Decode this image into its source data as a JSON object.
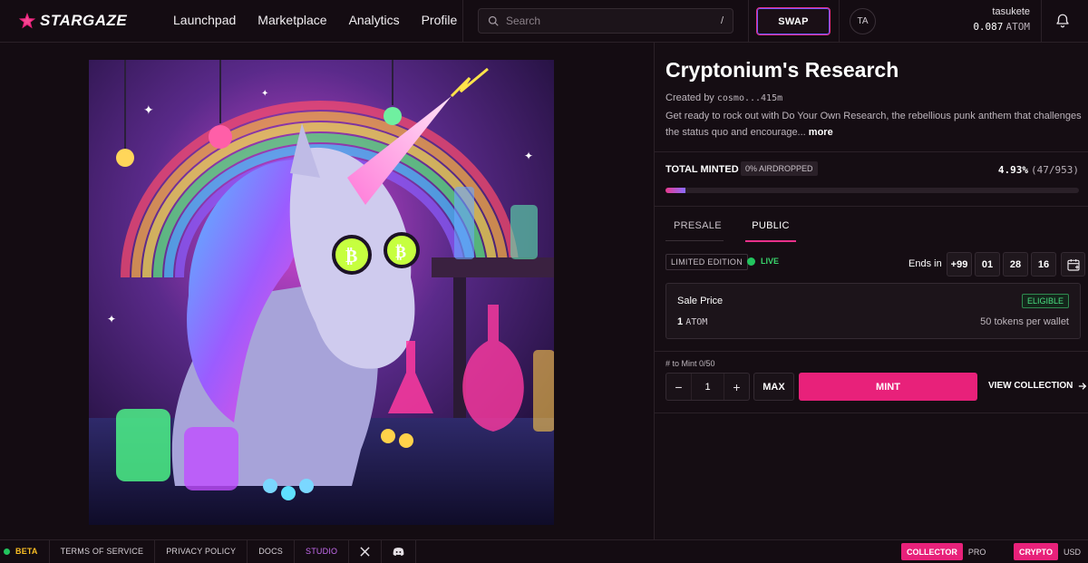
{
  "header": {
    "logo_text": "STARGAZE",
    "nav": [
      "Launchpad",
      "Marketplace",
      "Analytics",
      "Profile"
    ],
    "search_placeholder": "Search",
    "search_shortcut": "/",
    "swap_label": "SWAP",
    "avatar_initials": "TA",
    "username": "tasukete",
    "balance_value": "0.087",
    "balance_unit": "ATOM"
  },
  "collection": {
    "title": "Cryptonium's Research",
    "created_by_label": "Created by",
    "creator": "cosmo...415m",
    "description": "Get ready to rock out with Do Your Own Research, the rebellious punk anthem that challenges the status quo and encourage...",
    "more_label": "more",
    "total_minted_label": "TOTAL MINTED",
    "airdropped_badge": "0% AIRDROPPED",
    "minted_percent": "4.93%",
    "minted_count": "(47/953)",
    "progress_fraction": 0.0493
  },
  "mint": {
    "tabs": [
      "PRESALE",
      "PUBLIC"
    ],
    "active_tab": "PUBLIC",
    "edition_badge": "LIMITED EDITION",
    "live_label": "LIVE",
    "ends_label": "Ends in",
    "countdown": [
      "+99",
      "01",
      "28",
      "16"
    ],
    "sale_price_label": "Sale Price",
    "price_value": "1",
    "price_unit": "ATOM",
    "eligible_badge": "ELIGIBLE",
    "per_wallet": "50 tokens per wallet",
    "to_mint_label": "# to Mint 0/50",
    "quantity": "1",
    "minus": "−",
    "plus": "+",
    "max_label": "MAX",
    "mint_label": "MINT",
    "view_collection_label": "VIEW COLLECTION"
  },
  "footer": {
    "beta": "BETA",
    "links": [
      "TERMS OF SERVICE",
      "PRIVACY POLICY",
      "DOCS",
      "STUDIO"
    ],
    "mode_active": "COLLECTOR",
    "mode_inactive": "PRO",
    "currency_active": "CRYPTO",
    "currency_inactive": "USD"
  },
  "colors": {
    "accent": "#e8217a",
    "live": "#22c55e",
    "background": "#110a10"
  }
}
